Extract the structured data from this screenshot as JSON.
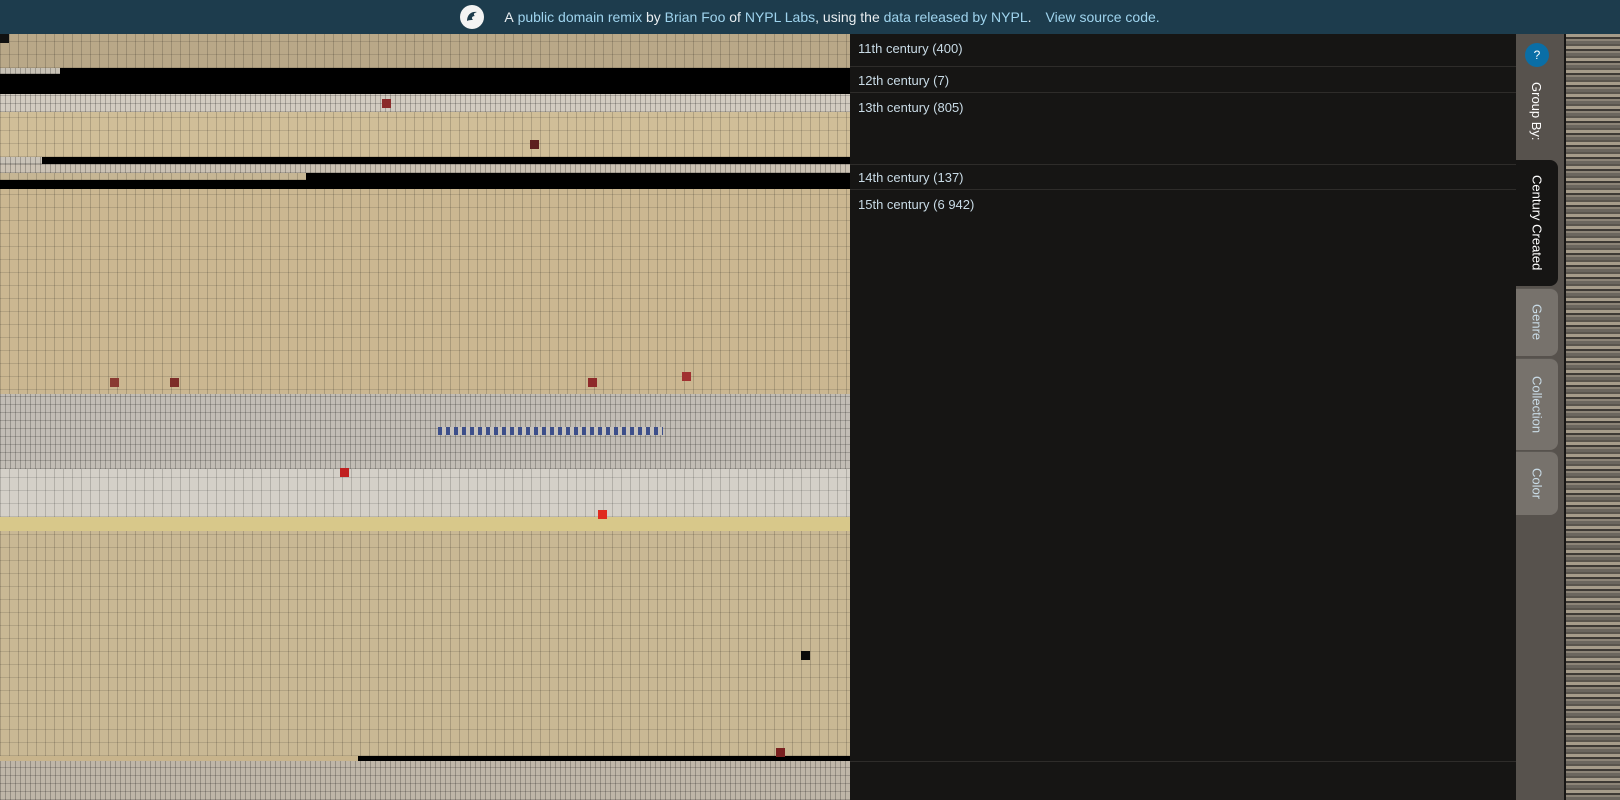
{
  "topbar": {
    "prefix": "A",
    "link1": "public domain remix",
    "by": "by",
    "link2": "Brian Foo",
    "of": "of",
    "link3": "NYPL Labs",
    "using": ", using the",
    "link4": "data released by NYPL",
    "period": ".",
    "source": "View source code."
  },
  "groups": [
    {
      "label": "11th century (400)"
    },
    {
      "label": "12th century (7)"
    },
    {
      "label": "13th century (805)"
    },
    {
      "label": "14th century (137)"
    },
    {
      "label": "15th century (6 942)"
    }
  ],
  "sidebar": {
    "help": "?",
    "group_by": "Group By:",
    "tabs": [
      {
        "label": "Century Created",
        "active": true
      },
      {
        "label": "Genre",
        "active": false
      },
      {
        "label": "Collection",
        "active": false
      },
      {
        "label": "Color",
        "active": false
      }
    ]
  },
  "colors": {
    "topbar": "#1d3c4d",
    "link": "#9fd4ee",
    "panel": "#161514",
    "sidebar": "#57524d",
    "help": "#0a6ea6"
  },
  "icons": {
    "logo": "nypl-lion-icon"
  }
}
